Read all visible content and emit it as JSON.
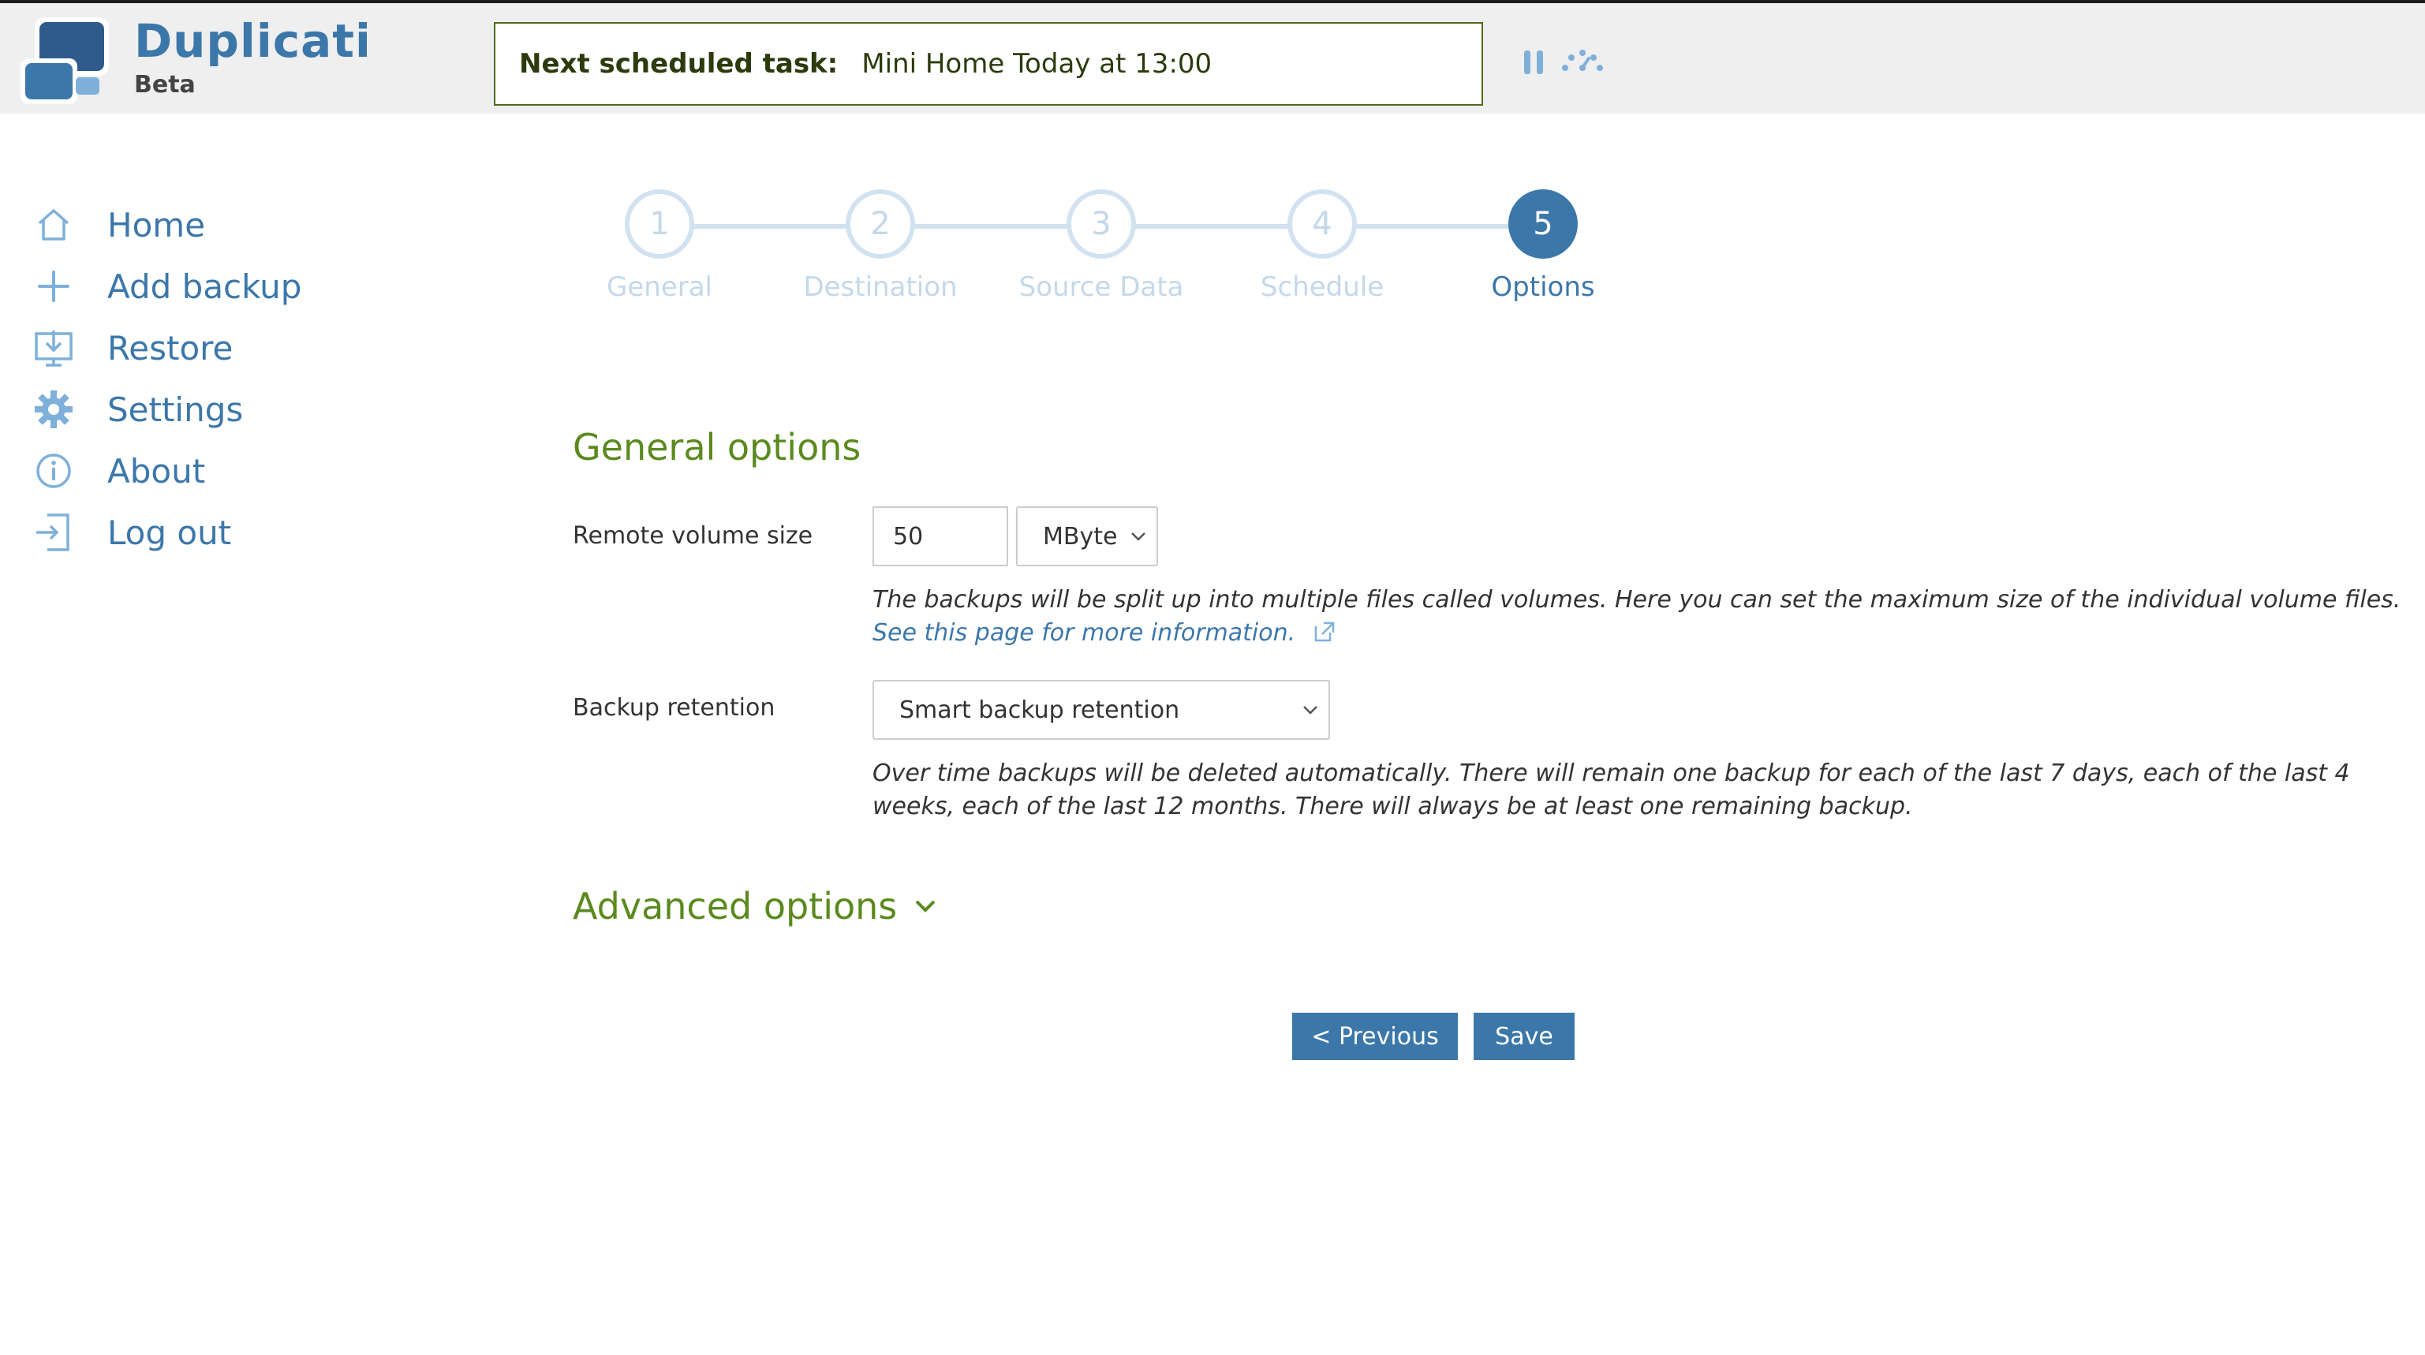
{
  "header": {
    "brand_name": "Duplicati",
    "brand_sub": "Beta",
    "next_task_label": "Next scheduled task:",
    "next_task_value": "Mini Home Today at 13:00"
  },
  "sidebar": {
    "items": [
      {
        "label": "Home",
        "icon": "home-icon"
      },
      {
        "label": "Add backup",
        "icon": "plus-icon"
      },
      {
        "label": "Restore",
        "icon": "restore-icon"
      },
      {
        "label": "Settings",
        "icon": "gear-icon"
      },
      {
        "label": "About",
        "icon": "info-icon"
      },
      {
        "label": "Log out",
        "icon": "logout-icon"
      }
    ]
  },
  "wizard": {
    "steps": [
      {
        "number": "1",
        "label": "General"
      },
      {
        "number": "2",
        "label": "Destination"
      },
      {
        "number": "3",
        "label": "Source Data"
      },
      {
        "number": "4",
        "label": "Schedule"
      },
      {
        "number": "5",
        "label": "Options"
      }
    ],
    "active_step": 5
  },
  "general_options": {
    "title": "General options",
    "remote_volume": {
      "label": "Remote volume size",
      "value": "50",
      "unit": "MByte",
      "help": "The backups will be split up into multiple files called volumes. Here you can set the maximum size of the individual volume files.",
      "link": "See this page for more information."
    },
    "retention": {
      "label": "Backup retention",
      "value": "Smart backup retention",
      "help_line1": "Over time backups will be deleted automatically. There will remain one backup for each of the last 7 days, each of the last 4",
      "help_line2": "weeks, each of the last 12 months. There will always be at least one remaining backup."
    }
  },
  "advanced": {
    "label": "Advanced options"
  },
  "buttons": {
    "previous": "< Previous",
    "save": "Save"
  },
  "colors": {
    "accent_blue": "#3c77aa",
    "section_green": "#5a8a1e",
    "step_inactive": "#d2e2f0",
    "topbar_bg": "#efefef"
  }
}
